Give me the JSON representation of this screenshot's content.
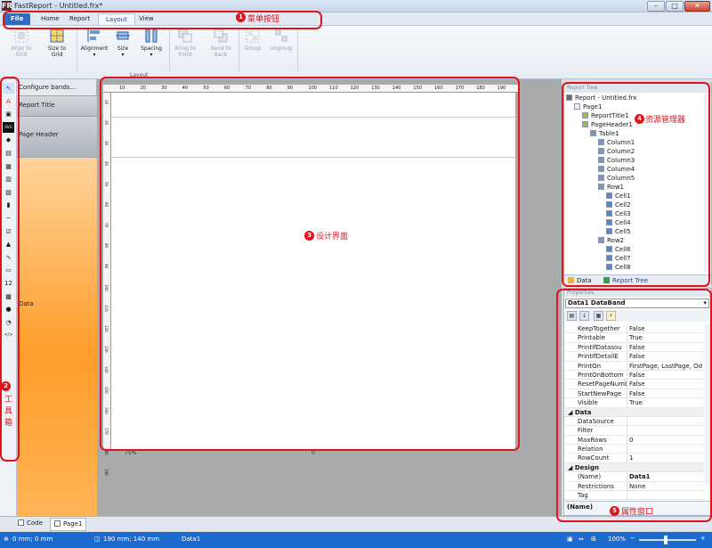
{
  "window": {
    "title": "FastReport - Untitled.frx*",
    "app_icon": "FR",
    "minimize": "–",
    "maximize": "□",
    "close": "✕"
  },
  "menu": {
    "file": "File",
    "home": "Home",
    "report": "Report",
    "layout": "Layout",
    "view": "View"
  },
  "ribbon": {
    "align_grid": "Align to\nGrid",
    "size_grid": "Size to\nGrid",
    "alignment": "Alignment",
    "size": "Size",
    "spacing": "Spacing",
    "bring_front": "Bring to\nFront",
    "send_back": "Send to\nBack",
    "group": "Group",
    "ungroup": "Ungroup",
    "group_label": "Layout"
  },
  "toolbox": {
    "tools": [
      {
        "icon": "pointer-icon",
        "glyph": "↖"
      },
      {
        "icon": "text-icon",
        "glyph": "A"
      },
      {
        "icon": "picture-icon",
        "glyph": "▣"
      },
      {
        "icon": "svg-icon",
        "glyph": "SVG"
      },
      {
        "icon": "shapes-icon",
        "glyph": "◆"
      },
      {
        "icon": "subreport-icon",
        "glyph": "▤"
      },
      {
        "icon": "table-icon",
        "glyph": "▦"
      },
      {
        "icon": "matrix-icon",
        "glyph": "▥"
      },
      {
        "icon": "richtext-icon",
        "glyph": "▧"
      },
      {
        "icon": "barcode-icon",
        "glyph": "▮"
      },
      {
        "icon": "line-icon",
        "glyph": "─"
      },
      {
        "icon": "checkbox-icon",
        "glyph": "☑"
      },
      {
        "icon": "chart-icon",
        "glyph": "▲"
      },
      {
        "icon": "sparkline-icon",
        "glyph": "∿"
      },
      {
        "icon": "zip-icon",
        "glyph": "▭"
      },
      {
        "icon": "cell-icon",
        "glyph": "12"
      },
      {
        "icon": "map-icon",
        "glyph": "▩"
      },
      {
        "icon": "globe-icon",
        "glyph": "●"
      },
      {
        "icon": "gauge-icon",
        "glyph": "◔"
      },
      {
        "icon": "html-icon",
        "glyph": "</>"
      }
    ]
  },
  "bands": {
    "configure": "Configure bands...",
    "report_title": "Report Title",
    "page_header": "Page Header",
    "data": "Data"
  },
  "ruler": {
    "ticks": [
      "10",
      "20",
      "30",
      "40",
      "50",
      "60",
      "70",
      "80",
      "90",
      "100",
      "110",
      "120",
      "130",
      "140",
      "150",
      "160",
      "170",
      "180",
      "190"
    ]
  },
  "design": {
    "zoom": "75%",
    "zero": "0"
  },
  "tree": {
    "header": "Report Tree",
    "items": [
      {
        "label": "Report - Untitled.frx",
        "level": 0,
        "icon": "report-icon"
      },
      {
        "label": "Page1",
        "level": 1,
        "icon": "page-icon"
      },
      {
        "label": "ReportTitle1",
        "level": 2,
        "icon": "band-icon"
      },
      {
        "label": "PageHeader1",
        "level": 2,
        "icon": "band-icon"
      },
      {
        "label": "Table1",
        "level": 3,
        "icon": "table-icon"
      },
      {
        "label": "Column1",
        "level": 4,
        "icon": "column-icon"
      },
      {
        "label": "Column2",
        "level": 4,
        "icon": "column-icon"
      },
      {
        "label": "Column3",
        "level": 4,
        "icon": "column-icon"
      },
      {
        "label": "Column4",
        "level": 4,
        "icon": "column-icon"
      },
      {
        "label": "Column5",
        "level": 4,
        "icon": "column-icon"
      },
      {
        "label": "Row1",
        "level": 4,
        "icon": "row-icon"
      },
      {
        "label": "Cell1",
        "level": 5,
        "icon": "cell-icon"
      },
      {
        "label": "Cell2",
        "level": 5,
        "icon": "cell-icon"
      },
      {
        "label": "Cell3",
        "level": 5,
        "icon": "cell-icon"
      },
      {
        "label": "Cell4",
        "level": 5,
        "icon": "cell-icon"
      },
      {
        "label": "Cell5",
        "level": 5,
        "icon": "cell-icon"
      },
      {
        "label": "Row2",
        "level": 4,
        "icon": "row-icon"
      },
      {
        "label": "Cell6",
        "level": 5,
        "icon": "cell-icon"
      },
      {
        "label": "Cell7",
        "level": 5,
        "icon": "cell-icon"
      },
      {
        "label": "Cell8",
        "level": 5,
        "icon": "cell-icon"
      }
    ],
    "tab_data": "Data",
    "tab_tree": "Report Tree"
  },
  "properties": {
    "header": "Properties",
    "object": "Data1 DataBand",
    "rows": [
      {
        "name": "KeepTogether",
        "value": "False"
      },
      {
        "name": "Printable",
        "value": "True"
      },
      {
        "name": "PrintIfDatasou",
        "value": "False"
      },
      {
        "name": "PrintIfDetailE",
        "value": "False"
      },
      {
        "name": "PrintOn",
        "value": "FirstPage, LastPage, Od"
      },
      {
        "name": "PrintOnBottom",
        "value": "False"
      },
      {
        "name": "ResetPageNumbe",
        "value": "False"
      },
      {
        "name": "StartNewPage",
        "value": "False"
      },
      {
        "name": "Visible",
        "value": "True"
      },
      {
        "name": "Data",
        "value": "",
        "category": true
      },
      {
        "name": "DataSource",
        "value": ""
      },
      {
        "name": "Filter",
        "value": ""
      },
      {
        "name": "MaxRows",
        "value": "0"
      },
      {
        "name": "Relation",
        "value": ""
      },
      {
        "name": "RowCount",
        "value": "1"
      },
      {
        "name": "Design",
        "value": "",
        "category": true
      },
      {
        "name": "(Name)",
        "value": "Data1"
      },
      {
        "name": "Restrictions",
        "value": "None"
      },
      {
        "name": "Tag",
        "value": ""
      }
    ],
    "description": "(Name)"
  },
  "bottom_tabs": {
    "code": "Code",
    "page": "Page1"
  },
  "status": {
    "location": "0 mm; 0 mm",
    "size": "190 mm; 140 mm",
    "object": "Data1",
    "zoom": "100%"
  },
  "annotations": {
    "menu": {
      "num": "1",
      "text": "菜单按钮"
    },
    "toolbox": {
      "num": "2",
      "text": "工\n具\n箱"
    },
    "design": {
      "num": "3",
      "text": "设计界面"
    },
    "tree": {
      "num": "4",
      "text": "资源管理器"
    },
    "props": {
      "num": "5",
      "text": "属性窗口"
    }
  },
  "colors": {
    "accent": "#2b6cc4",
    "callout": "#e0141c",
    "status": "#1e6bd0",
    "data_band": "#ff9d2a"
  }
}
